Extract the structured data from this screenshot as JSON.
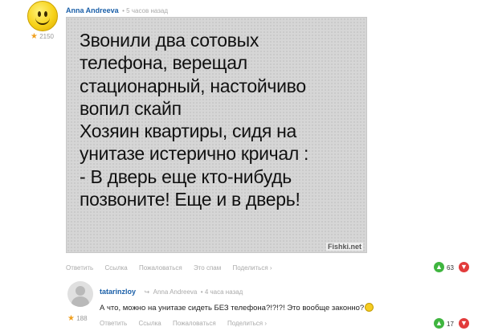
{
  "comment": {
    "author": "Anna Andreeva",
    "time": "5 часов назад",
    "rating": "2150",
    "meme_text": "Звонили два сотовых\nтелефона, верещал\nстационарный, настойчиво\nвопил скайп\nХозяин квартиры, сидя на\nунитазе истерично кричал :\n- В дверь еще кто-нибудь\nпозвоните! Еще и в дверь!",
    "watermark": "Fishki.net",
    "actions": [
      "Ответить",
      "Ссылка",
      "Пожаловаться",
      "Это спам",
      "Поделиться ›"
    ],
    "votes": "63"
  },
  "reply": {
    "author": "tatarinzloy",
    "reply_to": "Anna Andreeva",
    "time": "4 часа назад",
    "text": "А что, можно на унитазе сидеть БЕЗ телефона?!?!?! Это вообще законно?",
    "rating": "188",
    "actions": [
      "Ответить",
      "Ссылка",
      "Пожаловаться",
      "Поделиться ›"
    ],
    "votes": "17"
  },
  "icons": {
    "avatar1": "smiley-avatar",
    "avatar2": "default-user-avatar",
    "star": "star-icon",
    "reply_arrow": "reply-arrow-icon",
    "vote_up": "thumb-up-icon",
    "vote_down": "thumb-down-icon",
    "emoji": "shocked-emoji"
  },
  "colors": {
    "username": "#1a5fa8",
    "vote_up": "#3fb53f",
    "vote_down": "#e23b3b",
    "star": "#f0a020"
  }
}
